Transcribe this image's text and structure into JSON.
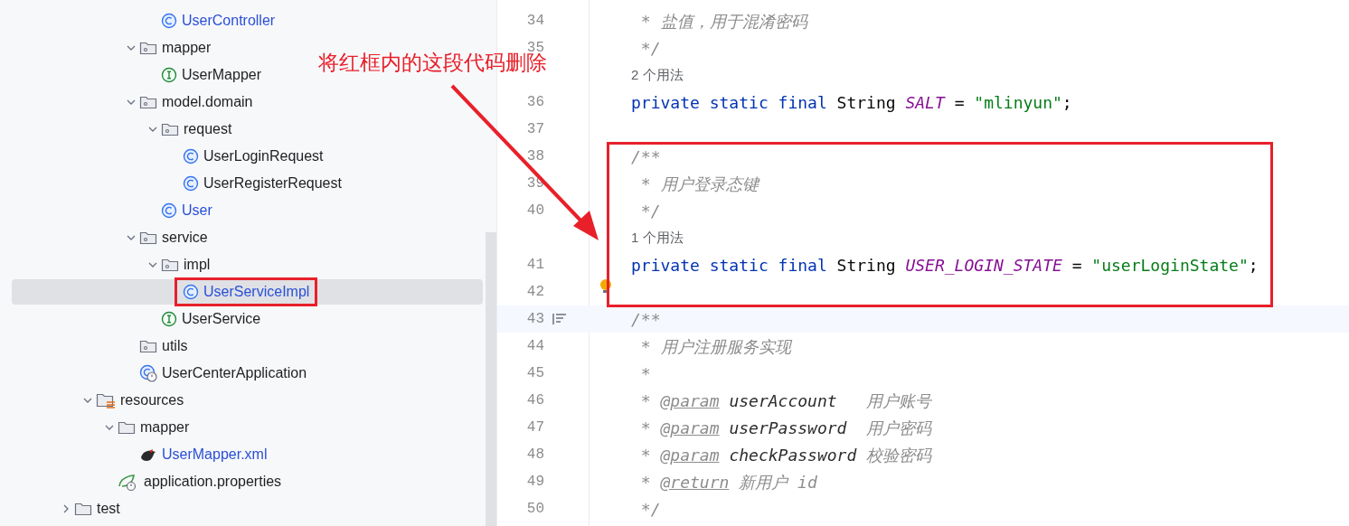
{
  "project_tree": [
    {
      "children": [
        {
          "children": [
            {
              "children": [
                {
                  "children": [
                    {
                      "label": "UserController",
                      "kind": "class",
                      "modified": true,
                      "selected": false,
                      "highlighted": false
                    }
                  ]
                },
                {
                  "label": "mapper",
                  "kind": "package",
                  "expanded": true,
                  "children": [
                    {
                      "label": "UserMapper",
                      "kind": "interface",
                      "modified": false,
                      "selected": false,
                      "highlighted": false
                    }
                  ]
                },
                {
                  "label": "model.domain",
                  "kind": "package",
                  "expanded": true,
                  "children": [
                    {
                      "label": "request",
                      "kind": "package",
                      "expanded": true,
                      "children": [
                        {
                          "label": "UserLoginRequest",
                          "kind": "class",
                          "modified": false,
                          "selected": false,
                          "highlighted": false
                        },
                        {
                          "label": "UserRegisterRequest",
                          "kind": "class",
                          "modified": false,
                          "selected": false,
                          "highlighted": false
                        }
                      ]
                    },
                    {
                      "label": "User",
                      "kind": "class",
                      "modified": true,
                      "selected": false,
                      "highlighted": false
                    }
                  ]
                },
                {
                  "label": "service",
                  "kind": "package",
                  "expanded": true,
                  "children": [
                    {
                      "label": "impl",
                      "kind": "package",
                      "expanded": true,
                      "children": [
                        {
                          "label": "UserServiceImpl",
                          "kind": "class",
                          "modified": true,
                          "selected": true,
                          "highlighted": true
                        }
                      ]
                    },
                    {
                      "label": "UserService",
                      "kind": "interface",
                      "modified": false,
                      "selected": false,
                      "highlighted": false
                    }
                  ]
                },
                {
                  "label": "utils",
                  "kind": "package"
                },
                {
                  "label": "UserCenterApplication",
                  "kind": "app-class",
                  "modified": false,
                  "selected": false,
                  "highlighted": false
                }
              ]
            }
          ]
        },
        {
          "label": "resources",
          "kind": "resources-folder",
          "expanded": true,
          "children": [
            {
              "label": "mapper",
              "kind": "folder",
              "expanded": true,
              "children": [
                {
                  "label": "UserMapper.xml",
                  "kind": "xml",
                  "modified": true,
                  "selected": false,
                  "highlighted": false
                }
              ]
            },
            {
              "label": "application.properties",
              "kind": "properties",
              "modified": false,
              "selected": false,
              "highlighted": false
            }
          ]
        }
      ]
    },
    {
      "label": "test",
      "kind": "folder",
      "expanded": false
    }
  ],
  "annotation": {
    "text": "将红框内的这段代码删除"
  },
  "editor": {
    "lines": [
      {
        "number": "34",
        "boxed": false,
        "current": false,
        "tokens": [
          {
            "kind": "comment",
            "text": " * 盐值，用于混淆密码"
          }
        ]
      },
      {
        "number": "35",
        "boxed": false,
        "current": false,
        "tokens": [
          {
            "kind": "comment",
            "text": " */"
          }
        ]
      },
      {
        "kind": "usage-hint",
        "text": "2 个用法",
        "boxed": false
      },
      {
        "number": "36",
        "boxed": false,
        "current": false,
        "tokens": [
          {
            "kind": "keyword",
            "text": "private static final "
          },
          {
            "kind": "plain",
            "text": "String "
          },
          {
            "kind": "constant",
            "text": "SALT"
          },
          {
            "kind": "plain",
            "text": " = "
          },
          {
            "kind": "string",
            "text": "\"mlinyun\""
          },
          {
            "kind": "plain",
            "text": ";"
          }
        ]
      },
      {
        "number": "37",
        "boxed": false,
        "current": false
      },
      {
        "number": "38",
        "boxed": true,
        "current": false,
        "tokens": [
          {
            "kind": "comment",
            "text": "/**"
          }
        ]
      },
      {
        "number": "39",
        "boxed": true,
        "current": false,
        "tokens": [
          {
            "kind": "comment",
            "text": " * 用户登录态键"
          }
        ]
      },
      {
        "number": "40",
        "boxed": true,
        "current": false,
        "tokens": [
          {
            "kind": "comment",
            "text": " */"
          }
        ]
      },
      {
        "kind": "usage-hint",
        "text": "1 个用法",
        "boxed": true
      },
      {
        "number": "41",
        "boxed": true,
        "current": false,
        "tokens": [
          {
            "kind": "keyword",
            "text": "private static final "
          },
          {
            "kind": "plain",
            "text": "String "
          },
          {
            "kind": "constant",
            "text": "USER_LOGIN_STATE"
          },
          {
            "kind": "plain",
            "text": " = "
          },
          {
            "kind": "string",
            "text": "\"userLoginState\""
          },
          {
            "kind": "plain",
            "text": ";"
          }
        ]
      },
      {
        "number": "42",
        "boxed": true,
        "current": false,
        "bulb": true
      },
      {
        "number": "43",
        "boxed": false,
        "current": true,
        "tokens": [
          {
            "kind": "comment",
            "text": "/**"
          }
        ]
      },
      {
        "number": "44",
        "boxed": false,
        "current": false,
        "tokens": [
          {
            "kind": "comment",
            "text": " * 用户注册服务实现"
          }
        ]
      },
      {
        "number": "45",
        "boxed": false,
        "current": false,
        "tokens": [
          {
            "kind": "comment",
            "text": " *"
          }
        ]
      },
      {
        "number": "46",
        "boxed": false,
        "current": false,
        "tokens": [
          {
            "kind": "comment",
            "text": " * "
          },
          {
            "kind": "doc-tag",
            "text": "@param"
          },
          {
            "kind": "doc-name",
            "text": " userAccount   "
          },
          {
            "kind": "comment",
            "text": "用户账号"
          }
        ]
      },
      {
        "number": "47",
        "boxed": false,
        "current": false,
        "tokens": [
          {
            "kind": "comment",
            "text": " * "
          },
          {
            "kind": "doc-tag",
            "text": "@param"
          },
          {
            "kind": "doc-name",
            "text": " userPassword  "
          },
          {
            "kind": "comment",
            "text": "用户密码"
          }
        ]
      },
      {
        "number": "48",
        "boxed": false,
        "current": false,
        "tokens": [
          {
            "kind": "comment",
            "text": " * "
          },
          {
            "kind": "doc-tag",
            "text": "@param"
          },
          {
            "kind": "doc-name",
            "text": " checkPassword "
          },
          {
            "kind": "comment",
            "text": "校验密码"
          }
        ]
      },
      {
        "number": "49",
        "boxed": false,
        "current": false,
        "tokens": [
          {
            "kind": "comment",
            "text": " * "
          },
          {
            "kind": "doc-tag",
            "text": "@return"
          },
          {
            "kind": "comment",
            "text": " 新用户 id"
          }
        ]
      },
      {
        "number": "50",
        "boxed": false,
        "current": false,
        "tokens": [
          {
            "kind": "comment",
            "text": " */"
          }
        ]
      }
    ]
  }
}
